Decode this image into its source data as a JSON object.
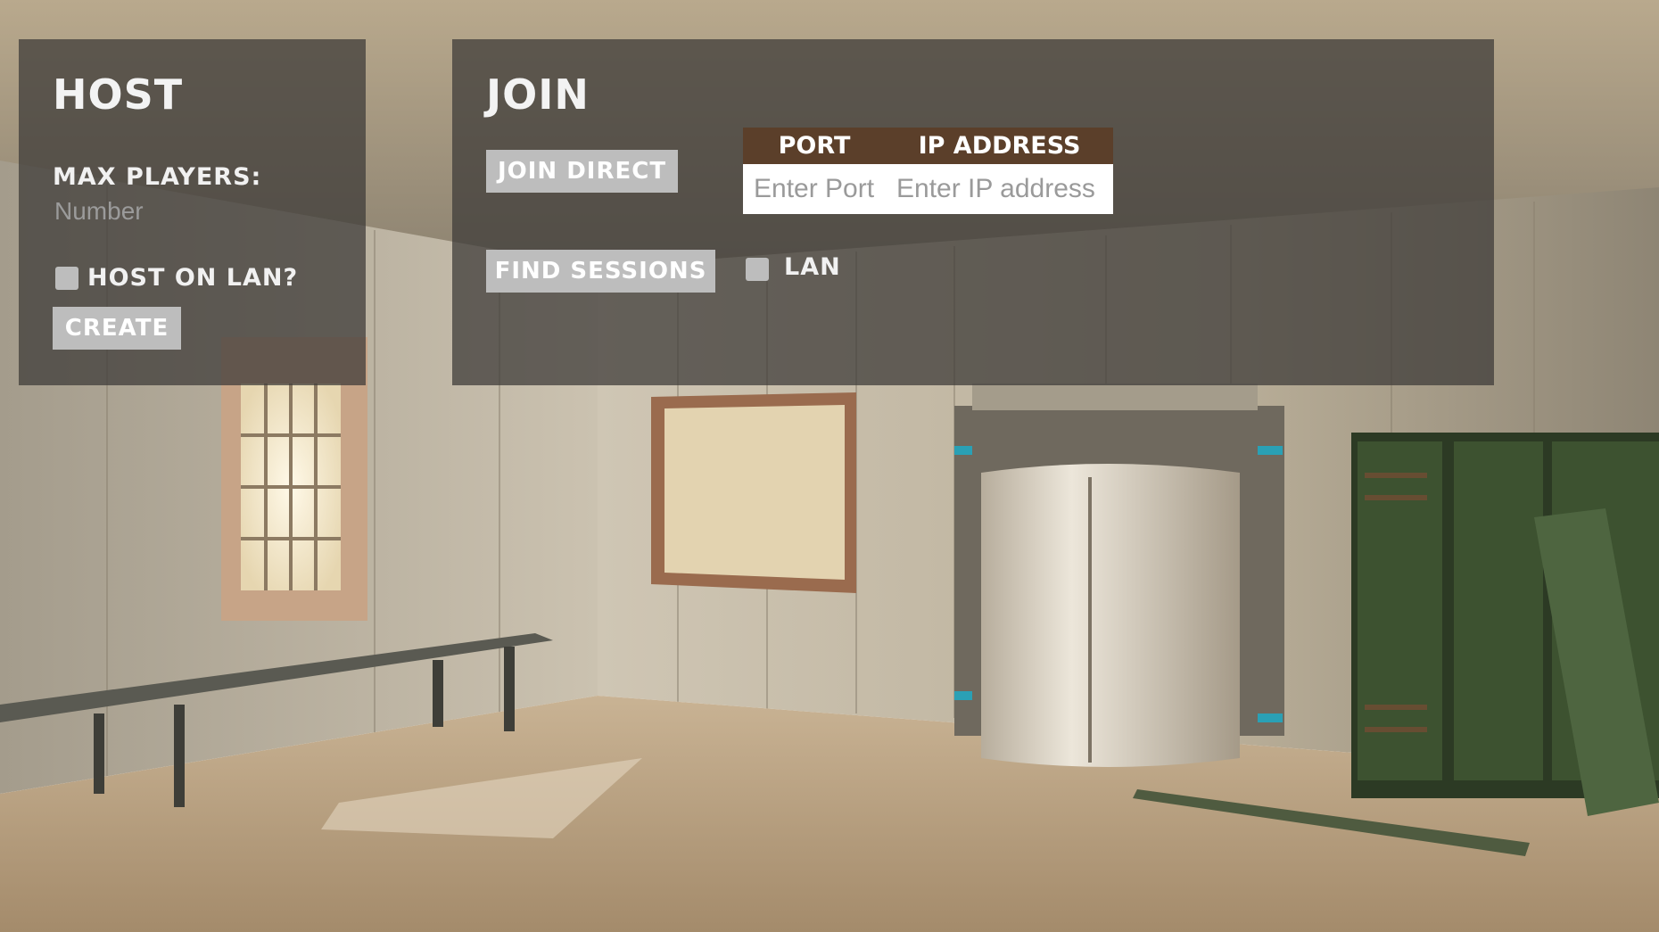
{
  "host": {
    "title": "HOST",
    "max_players_label": "MAX PLAYERS:",
    "max_players_placeholder": "Number",
    "host_on_lan_label": "HOST ON LAN?",
    "create_label": "CREATE"
  },
  "join": {
    "title": "JOIN",
    "join_direct_label": "JOIN DIRECT",
    "find_sessions_label": "FIND SESSIONS",
    "lan_label": "LAN",
    "port_header": "PORT",
    "ip_header": "IP ADDRESS",
    "port_placeholder": "Enter Port",
    "ip_placeholder": "Enter IP address"
  },
  "colors": {
    "panel_bg": "#3e3c38",
    "button_bg": "#bdbdbd",
    "table_header_bg": "#5b3f2a"
  }
}
